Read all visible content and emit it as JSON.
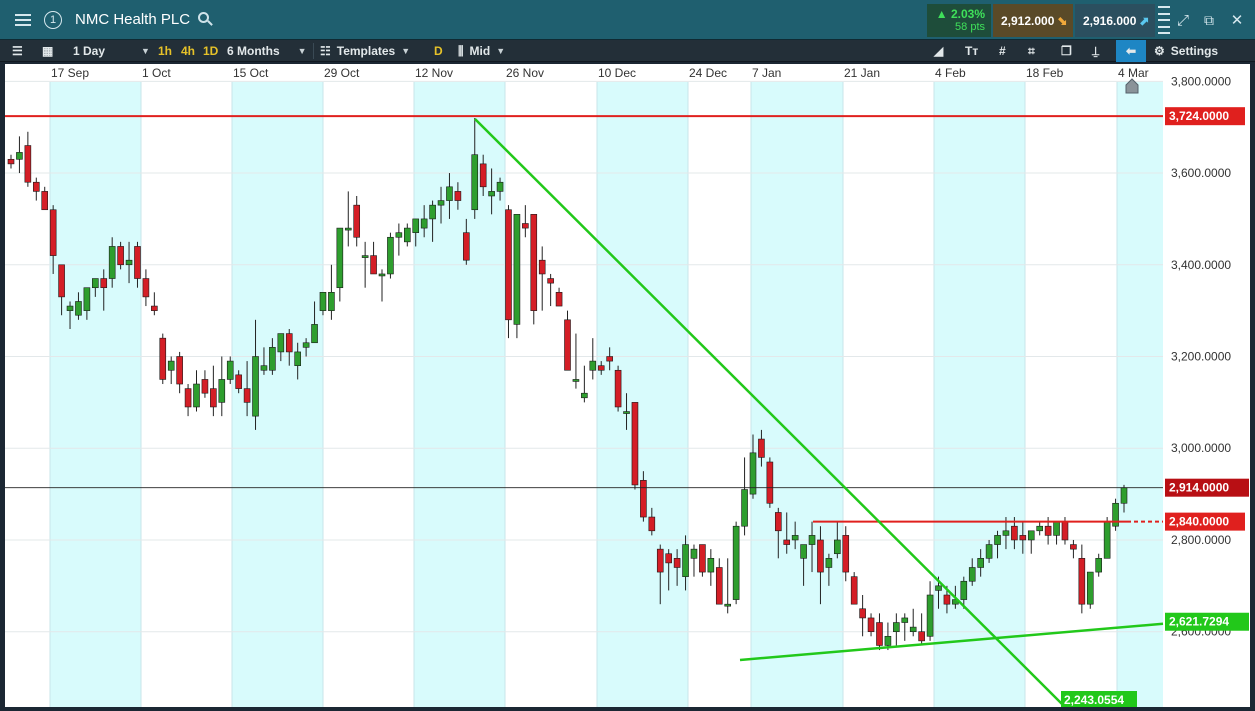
{
  "title_bar": {
    "menu_icon": "hamburger-menu-icon",
    "badge_number": "1",
    "instrument": "NMC Health PLC",
    "search_icon": "search-icon",
    "change_percent": "▲ 2.03%",
    "change_points": "58 pts",
    "sell_price": "2,912.000",
    "buy_price": "2,916.000",
    "colors": {
      "bar": "#1f5f6f",
      "up": "#3fe05a",
      "sell_bg": "#5a4a28",
      "buy_bg": "#2b4f5f"
    }
  },
  "toolbar": {
    "interval": "1 Day",
    "quick_1h": "1h",
    "quick_4h": "4h",
    "quick_1d": "1D",
    "range": "6 Months",
    "templates": "Templates",
    "d_badge": "D",
    "price_type": "Mid",
    "settings": "Settings",
    "active_color": "#1e86c4"
  },
  "chart_data": {
    "type": "candlestick",
    "x_dates": [
      "17 Sep",
      "1 Oct",
      "15 Oct",
      "29 Oct",
      "12 Nov",
      "26 Nov",
      "10 Dec",
      "24 Dec",
      "7 Jan",
      "21 Jan",
      "4 Feb",
      "18 Feb",
      "4 Mar"
    ],
    "y_ticks": [
      "3,800.0000",
      "3,600.0000",
      "3,400.0000",
      "3,200.0000",
      "3,000.0000",
      "2,800.0000",
      "2,600.0000"
    ],
    "y_tick_values": [
      3800,
      3600,
      3400,
      3200,
      3000,
      2800,
      2600
    ],
    "ylim": [
      2500,
      3820
    ],
    "current_price": "2,914.0000",
    "current_value": 2914,
    "horizontal_lines": [
      {
        "label": "3,724.0000",
        "value": 3724,
        "color": "#e0201e"
      },
      {
        "label": "2,840.0000",
        "value": 2840,
        "color": "#e0201e"
      }
    ],
    "trend_labels": [
      {
        "label": "2,621.7294",
        "value": 2621.7294,
        "color": "#22c81a"
      },
      {
        "label": "2,243.0554",
        "value": 2243.0554,
        "color": "#22c81a"
      }
    ],
    "up_color": "#2e9e2e",
    "down_color": "#d41e26",
    "candles": [
      [
        3630,
        3640,
        3610,
        3620
      ],
      [
        3630,
        3680,
        3600,
        3645
      ],
      [
        3660,
        3690,
        3570,
        3580
      ],
      [
        3580,
        3590,
        3540,
        3560
      ],
      [
        3560,
        3570,
        3520,
        3520
      ],
      [
        3520,
        3530,
        3380,
        3420
      ],
      [
        3400,
        3400,
        3290,
        3330
      ],
      [
        3300,
        3320,
        3260,
        3310
      ],
      [
        3290,
        3340,
        3280,
        3320
      ],
      [
        3300,
        3350,
        3280,
        3350
      ],
      [
        3350,
        3370,
        3330,
        3370
      ],
      [
        3370,
        3390,
        3300,
        3350
      ],
      [
        3370,
        3460,
        3350,
        3440
      ],
      [
        3440,
        3450,
        3390,
        3400
      ],
      [
        3400,
        3450,
        3360,
        3410
      ],
      [
        3440,
        3450,
        3350,
        3370
      ],
      [
        3370,
        3390,
        3310,
        3330
      ],
      [
        3310,
        3340,
        3290,
        3300
      ],
      [
        3240,
        3250,
        3140,
        3150
      ],
      [
        3170,
        3200,
        3140,
        3190
      ],
      [
        3200,
        3210,
        3120,
        3140
      ],
      [
        3130,
        3140,
        3070,
        3090
      ],
      [
        3090,
        3170,
        3080,
        3140
      ],
      [
        3150,
        3170,
        3110,
        3120
      ],
      [
        3130,
        3180,
        3070,
        3090
      ],
      [
        3100,
        3200,
        3070,
        3150
      ],
      [
        3150,
        3200,
        3140,
        3190
      ],
      [
        3160,
        3170,
        3120,
        3130
      ],
      [
        3130,
        3190,
        3070,
        3100
      ],
      [
        3070,
        3280,
        3040,
        3200
      ],
      [
        3170,
        3220,
        3160,
        3180
      ],
      [
        3170,
        3240,
        3160,
        3220
      ],
      [
        3210,
        3250,
        3190,
        3250
      ],
      [
        3250,
        3260,
        3180,
        3210
      ],
      [
        3180,
        3230,
        3150,
        3210
      ],
      [
        3220,
        3240,
        3200,
        3230
      ],
      [
        3230,
        3320,
        3230,
        3270
      ],
      [
        3300,
        3340,
        3290,
        3340
      ],
      [
        3300,
        3400,
        3280,
        3340
      ],
      [
        3350,
        3450,
        3320,
        3480
      ],
      [
        3480,
        3560,
        3440,
        3480
      ],
      [
        3530,
        3550,
        3440,
        3460
      ],
      [
        3420,
        3450,
        3350,
        3420
      ],
      [
        3420,
        3450,
        3380,
        3380
      ],
      [
        3380,
        3390,
        3320,
        3380
      ],
      [
        3380,
        3470,
        3370,
        3460
      ],
      [
        3460,
        3490,
        3420,
        3470
      ],
      [
        3450,
        3490,
        3440,
        3480
      ],
      [
        3470,
        3500,
        3440,
        3500
      ],
      [
        3480,
        3530,
        3460,
        3500
      ],
      [
        3500,
        3540,
        3450,
        3530
      ],
      [
        3530,
        3570,
        3490,
        3540
      ],
      [
        3540,
        3600,
        3500,
        3570
      ],
      [
        3560,
        3580,
        3520,
        3540
      ],
      [
        3470,
        3500,
        3400,
        3410
      ],
      [
        3520,
        3720,
        3500,
        3640
      ],
      [
        3620,
        3640,
        3550,
        3570
      ],
      [
        3550,
        3610,
        3510,
        3560
      ],
      [
        3560,
        3590,
        3540,
        3580
      ],
      [
        3520,
        3530,
        3240,
        3280
      ],
      [
        3270,
        3490,
        3240,
        3510
      ],
      [
        3490,
        3530,
        3460,
        3480
      ],
      [
        3510,
        3510,
        3270,
        3300
      ],
      [
        3410,
        3440,
        3300,
        3380
      ],
      [
        3370,
        3380,
        3310,
        3360
      ],
      [
        3340,
        3350,
        3320,
        3310
      ],
      [
        3280,
        3300,
        3180,
        3170
      ],
      [
        3150,
        3250,
        3130,
        3150
      ],
      [
        3110,
        3180,
        3100,
        3120
      ],
      [
        3170,
        3240,
        3150,
        3190
      ],
      [
        3180,
        3190,
        3160,
        3170
      ],
      [
        3200,
        3220,
        3170,
        3190
      ],
      [
        3170,
        3180,
        3080,
        3090
      ],
      [
        3080,
        3120,
        3040,
        3080
      ],
      [
        3100,
        3100,
        2910,
        2920
      ],
      [
        2930,
        2950,
        2840,
        2850
      ],
      [
        2850,
        2870,
        2810,
        2820
      ],
      [
        2780,
        2790,
        2660,
        2730
      ],
      [
        2770,
        2780,
        2690,
        2750
      ],
      [
        2760,
        2780,
        2700,
        2740
      ],
      [
        2720,
        2810,
        2690,
        2790
      ],
      [
        2760,
        2790,
        2720,
        2780
      ],
      [
        2790,
        2790,
        2720,
        2730
      ],
      [
        2730,
        2780,
        2700,
        2760
      ],
      [
        2740,
        2760,
        2660,
        2660
      ],
      [
        2660,
        2760,
        2640,
        2660
      ],
      [
        2670,
        2840,
        2660,
        2830
      ],
      [
        2830,
        2980,
        2810,
        2910
      ],
      [
        2900,
        3030,
        2890,
        2990
      ],
      [
        3020,
        3040,
        2960,
        2980
      ],
      [
        2970,
        2980,
        2870,
        2880
      ],
      [
        2860,
        2870,
        2760,
        2820
      ],
      [
        2800,
        2860,
        2770,
        2790
      ],
      [
        2800,
        2840,
        2780,
        2810
      ],
      [
        2760,
        2780,
        2700,
        2790
      ],
      [
        2790,
        2840,
        2730,
        2810
      ],
      [
        2800,
        2830,
        2660,
        2730
      ],
      [
        2740,
        2770,
        2700,
        2760
      ],
      [
        2770,
        2840,
        2760,
        2800
      ],
      [
        2810,
        2830,
        2710,
        2730
      ],
      [
        2720,
        2730,
        2660,
        2660
      ],
      [
        2650,
        2680,
        2590,
        2630
      ],
      [
        2630,
        2640,
        2590,
        2600
      ],
      [
        2620,
        2640,
        2560,
        2570
      ],
      [
        2570,
        2620,
        2560,
        2590
      ],
      [
        2600,
        2640,
        2570,
        2620
      ],
      [
        2620,
        2640,
        2580,
        2630
      ],
      [
        2600,
        2650,
        2590,
        2610
      ],
      [
        2600,
        2640,
        2570,
        2580
      ],
      [
        2590,
        2710,
        2580,
        2680
      ],
      [
        2690,
        2720,
        2650,
        2700
      ],
      [
        2680,
        2700,
        2640,
        2660
      ],
      [
        2660,
        2700,
        2650,
        2670
      ],
      [
        2670,
        2720,
        2650,
        2710
      ],
      [
        2710,
        2760,
        2700,
        2740
      ],
      [
        2740,
        2780,
        2720,
        2760
      ],
      [
        2760,
        2800,
        2750,
        2790
      ],
      [
        2790,
        2820,
        2760,
        2810
      ],
      [
        2810,
        2850,
        2780,
        2820
      ],
      [
        2830,
        2850,
        2780,
        2800
      ],
      [
        2810,
        2840,
        2770,
        2800
      ],
      [
        2800,
        2820,
        2770,
        2820
      ],
      [
        2820,
        2840,
        2810,
        2830
      ],
      [
        2830,
        2850,
        2790,
        2810
      ],
      [
        2810,
        2840,
        2790,
        2840
      ],
      [
        2840,
        2850,
        2790,
        2800
      ],
      [
        2790,
        2800,
        2760,
        2780
      ],
      [
        2760,
        2790,
        2640,
        2660
      ],
      [
        2660,
        2730,
        2650,
        2730
      ],
      [
        2730,
        2770,
        2720,
        2760
      ],
      [
        2760,
        2850,
        2760,
        2840
      ],
      [
        2830,
        2890,
        2820,
        2880
      ],
      [
        2880,
        2920,
        2860,
        2914
      ]
    ]
  }
}
